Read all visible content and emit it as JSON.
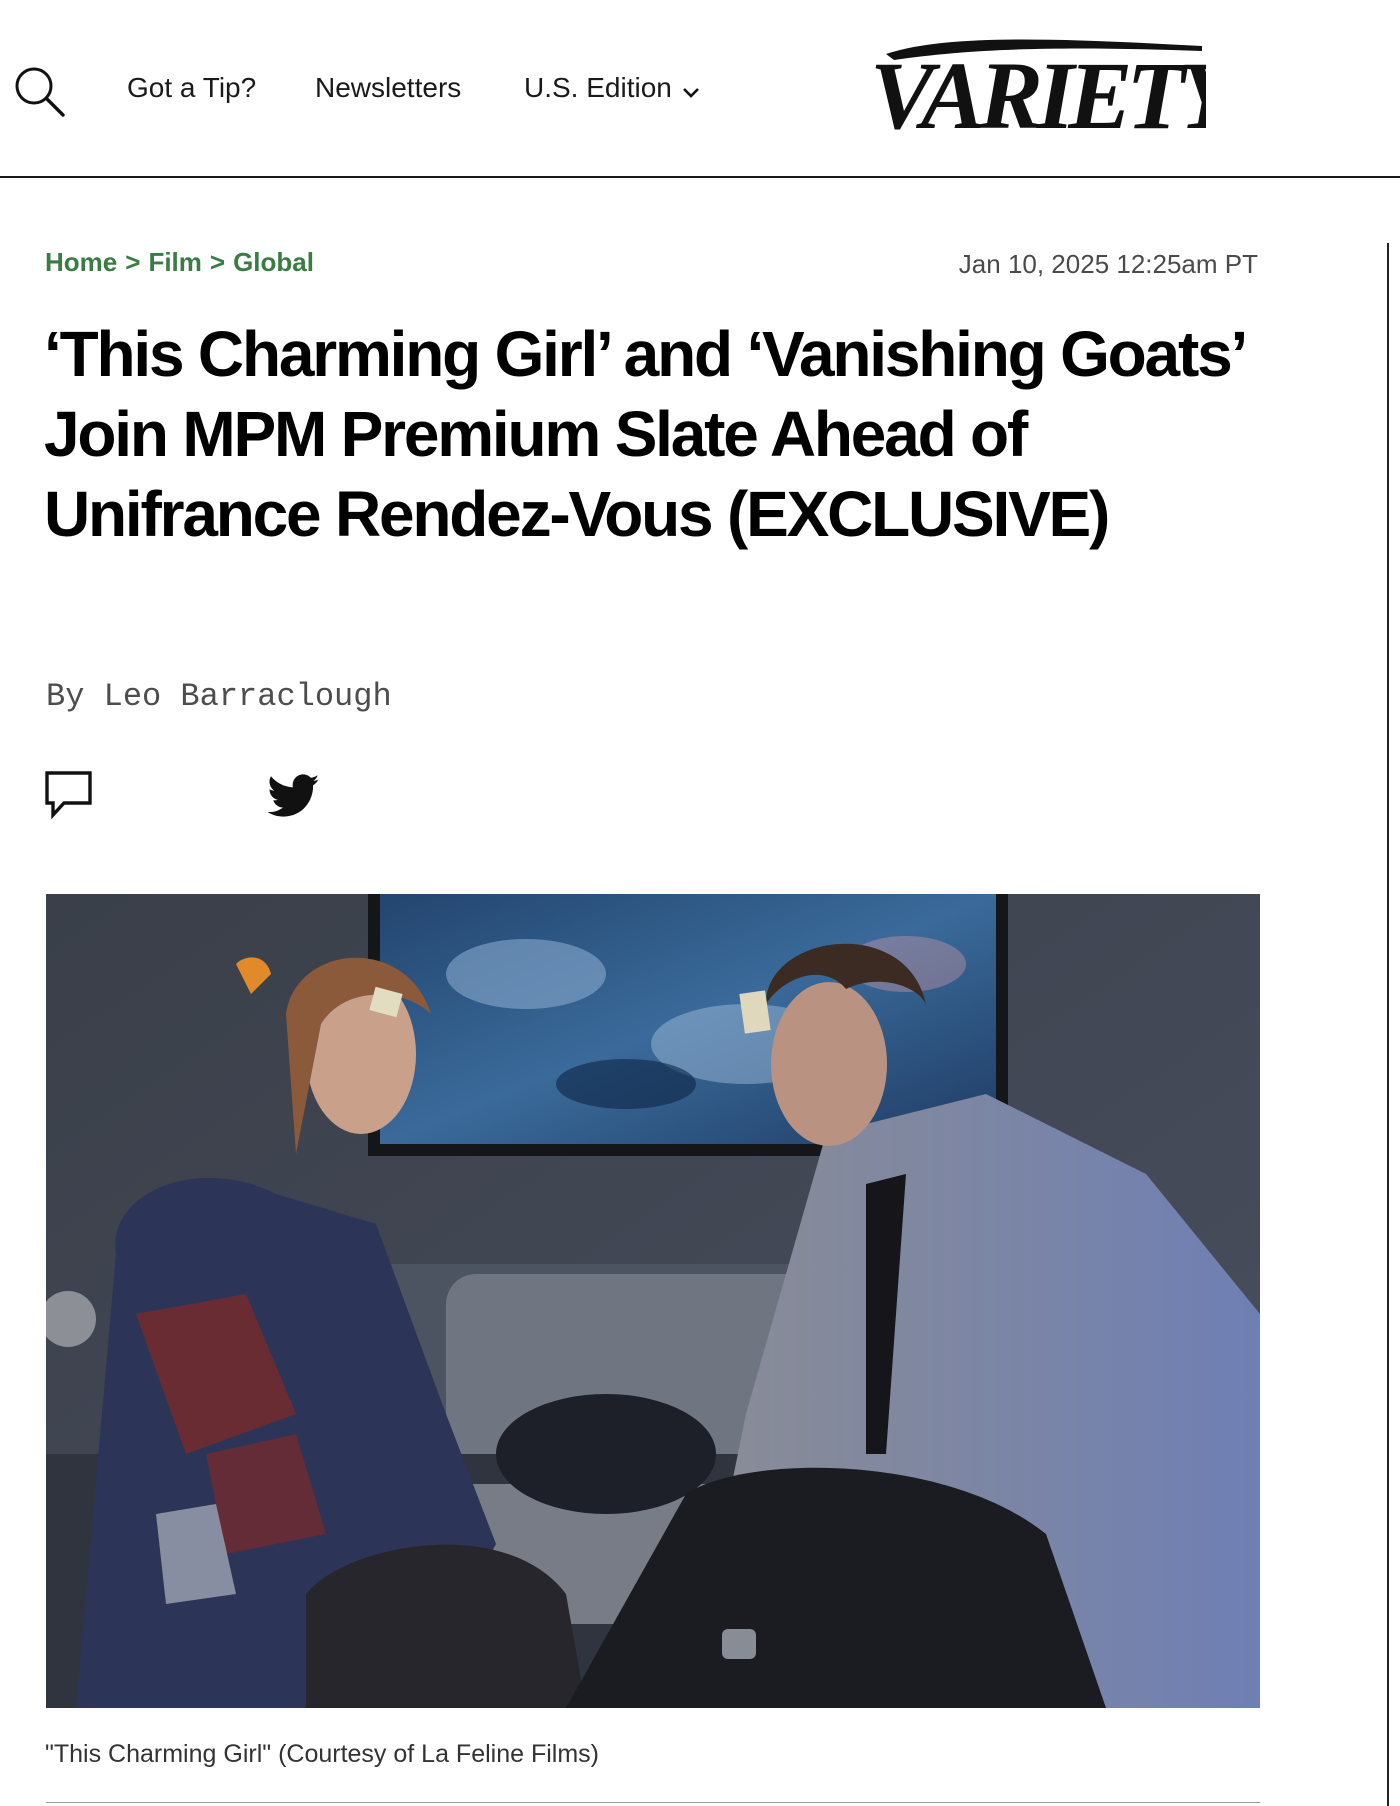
{
  "header": {
    "search_icon": "search-icon",
    "nav": {
      "tip": "Got a Tip?",
      "newsletters": "Newsletters",
      "edition": "U.S. Edition"
    },
    "logo_text": "VARIETY"
  },
  "breadcrumb": {
    "items": [
      "Home",
      "Film",
      "Global"
    ],
    "separator": ">"
  },
  "article": {
    "date": "Jan 10, 2025 12:25am PT",
    "headline": "‘This Charming Girl’ and ‘Vanishing Goats’ Join MPM Premium Slate Ahead of Unifrance Rendez-Vous (EXCLUSIVE)",
    "byline_prefix": "By",
    "author": "Leo Barraclough",
    "share_icons": [
      "comment-icon",
      "twitter-icon"
    ],
    "image_caption": "\"This Charming Girl\" (Courtesy of La Feline Films)"
  },
  "colors": {
    "breadcrumb": "#3a7d44",
    "text": "#000000",
    "muted": "#4a4a4a"
  }
}
